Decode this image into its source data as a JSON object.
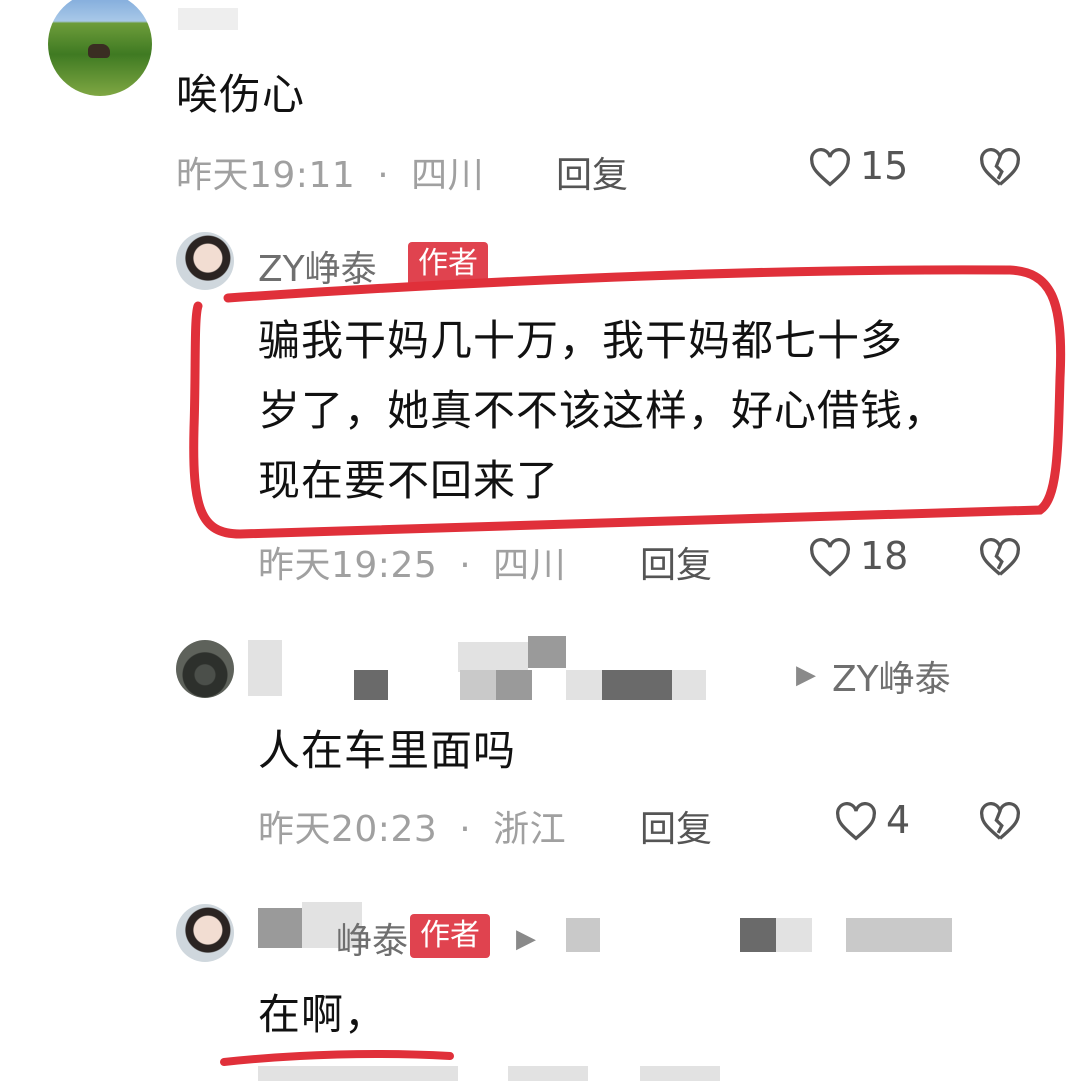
{
  "comments": [
    {
      "text": "唉伤心",
      "time": "昨天19:11",
      "dot": "·",
      "location": "四川",
      "reply_label": "回复",
      "likes": "15"
    },
    {
      "username": "ZY峥泰",
      "badge": "作者",
      "text_lines": [
        "骗我干妈几十万，我干妈都七十多",
        "岁了，她真不不该这样，好心借钱，",
        "现在要不回来了"
      ],
      "time": "昨天19:25",
      "dot": "·",
      "location": "四川",
      "reply_label": "回复",
      "likes": "18"
    },
    {
      "reply_to": "ZY峥泰",
      "text": "人在车里面吗",
      "time": "昨天20:23",
      "dot": "·",
      "location": "浙江",
      "reply_label": "回复",
      "likes": "4"
    },
    {
      "username_partial": "峥泰",
      "badge": "作者",
      "text": "在啊，"
    }
  ],
  "colors": {
    "annotation_red": "#e0303a",
    "author_badge": "#e0434f",
    "meta_gray": "#a0a0a0"
  },
  "icons": [
    "heart-outline-icon",
    "broken-heart-icon",
    "play-arrow-icon"
  ]
}
